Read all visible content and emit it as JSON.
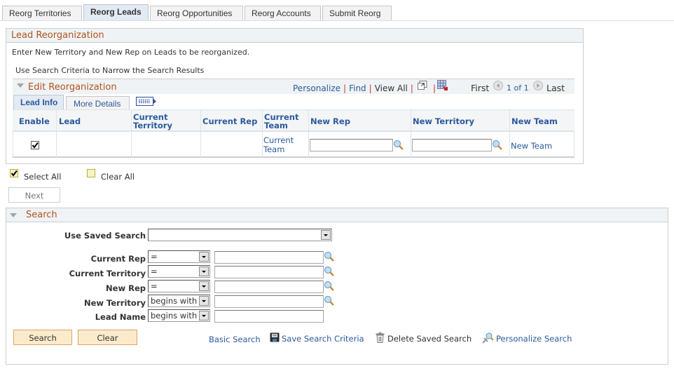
{
  "tabs": [
    {
      "label": "Reorg Territories",
      "active": false
    },
    {
      "label": "Reorg Leads",
      "active": true
    },
    {
      "label": "Reorg Opportunities",
      "active": false
    },
    {
      "label": "Reorg Accounts",
      "active": false
    },
    {
      "label": "Submit Reorg",
      "active": false
    }
  ],
  "lead_reorg": {
    "title": "Lead Reorganization",
    "instruction": "Enter New Territory and New Rep on Leads to be reorganized.",
    "hint": "Use Search Criteria to Narrow the Search Results"
  },
  "grid": {
    "title": "Edit Reorganization",
    "toolbar": {
      "personalize": "Personalize",
      "find": "Find",
      "view_all": "View All",
      "first": "First",
      "page_info": "1 of 1",
      "last": "Last"
    },
    "subtabs": [
      {
        "label": "Lead Info",
        "active": true
      },
      {
        "label": "More Details",
        "active": false
      }
    ],
    "columns": [
      "Enable",
      "Lead",
      "Current Territory",
      "Current Rep",
      "Current Team",
      "New Rep",
      "New Territory",
      "New Team"
    ],
    "rows": [
      {
        "enable": true,
        "lead": "",
        "current_territory": "",
        "current_rep": "",
        "current_team": "Current Team",
        "new_rep": "",
        "new_territory": "",
        "new_team": "New Team"
      }
    ]
  },
  "actions": {
    "select_all": "Select All",
    "clear_all": "Clear All",
    "next": "Next"
  },
  "search": {
    "title": "Search",
    "saved_search_label": "Use Saved Search",
    "saved_search_value": "",
    "criteria": [
      {
        "label": "Current Rep",
        "operator": "=",
        "value": "",
        "lookup": true
      },
      {
        "label": "Current Territory",
        "operator": "=",
        "value": "",
        "lookup": true
      },
      {
        "label": "New Rep",
        "operator": "=",
        "value": "",
        "lookup": true
      },
      {
        "label": "New Territory",
        "operator": "begins with",
        "value": "",
        "lookup": true
      },
      {
        "label": "Lead Name",
        "operator": "begins with",
        "value": "",
        "lookup": false
      }
    ],
    "search_button": "Search",
    "clear_button": "Clear",
    "basic_search": "Basic Search",
    "save_criteria": "Save Search Criteria",
    "delete_saved": "Delete Saved Search",
    "personalize_search": "Personalize Search"
  },
  "colors": {
    "header_orange": "#b1531b",
    "link_blue": "#2c5a9c",
    "button_bg": "#fcebcb"
  }
}
